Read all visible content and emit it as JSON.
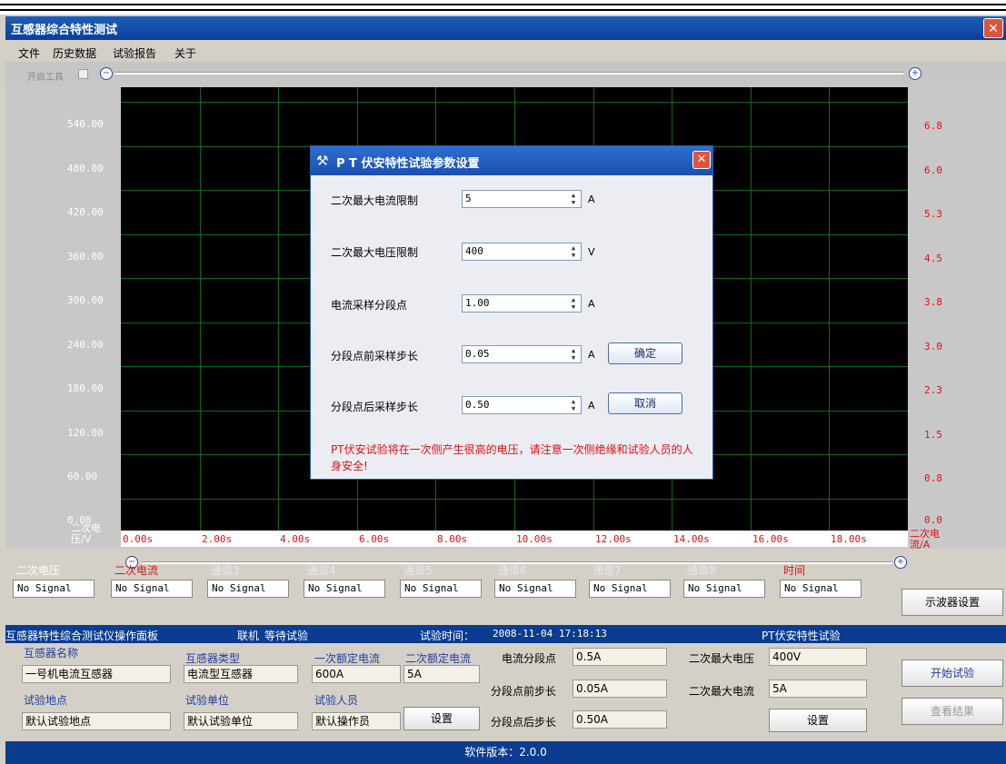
{
  "window": {
    "title": "互感器综合特性测试",
    "close_glyph": "✕"
  },
  "menu": [
    "文件",
    "历史数据",
    "试验报告",
    "关于"
  ],
  "toolbar": {
    "label": "开启工具"
  },
  "chart_data": {
    "type": "line",
    "x_ticks": [
      "0.00s",
      "2.00s",
      "4.00s",
      "6.00s",
      "8.00s",
      "10.00s",
      "12.00s",
      "14.00s",
      "16.00s",
      "18.00s"
    ],
    "y_left_ticks": [
      "540.00",
      "480.00",
      "420.00",
      "360.00",
      "300.00",
      "240.00",
      "180.00",
      "120.00",
      "60.00",
      "0.00"
    ],
    "y_right_ticks": [
      "6.8",
      "6.0",
      "5.3",
      "4.5",
      "3.8",
      "3.0",
      "2.3",
      "1.5",
      "0.8",
      "0.0"
    ],
    "ylabel_left": "二次电压/V",
    "ylabel_right": "二次电流/A",
    "series": []
  },
  "channels": [
    {
      "name": "二次电压",
      "value": "No Signal",
      "color": "#ffffff"
    },
    {
      "name": "二次电流",
      "value": "No Signal",
      "color": "#e01010"
    },
    {
      "name": "通道3",
      "value": "No Signal",
      "color": "#e8e8e8"
    },
    {
      "name": "通道4",
      "value": "No Signal",
      "color": "#e8e8e8"
    },
    {
      "name": "通道5",
      "value": "No Signal",
      "color": "#e8e8e8"
    },
    {
      "name": "通道6",
      "value": "No Signal",
      "color": "#e8e8e8"
    },
    {
      "name": "通道7",
      "value": "No Signal",
      "color": "#e8e8e8"
    },
    {
      "name": "通道8",
      "value": "No Signal",
      "color": "#e8e8e8"
    },
    {
      "name": "时间",
      "value": "No Signal",
      "color": "#e01010"
    }
  ],
  "scope_button": "示波器设置",
  "op_header": {
    "title": "互感器特性综合测试仪操作面板",
    "status": "联机",
    "state": "等待试验",
    "time_label": "试验时间：",
    "time_value": "2008-11-04 17:18:13",
    "test_type": "PT伏安特性试验"
  },
  "op": {
    "name_label": "互感器名称",
    "name_value": "一号机电流互感器",
    "type_label": "互感器类型",
    "type_value": "电流型互感器",
    "primary_label": "一次额定电流",
    "primary_value": "600A",
    "secondary_label": "二次额定电流",
    "secondary_value": "5A",
    "site_label": "试验地点",
    "site_value": "默认试验地点",
    "unit_label": "试验单位",
    "unit_value": "默认试验单位",
    "person_label": "试验人员",
    "person_value": "默认操作员",
    "setup_btn": "设置",
    "seg_label": "电流分段点",
    "seg_value": "0.5A",
    "before_label": "分段点前步长",
    "before_value": "0.05A",
    "after_label": "分段点后步长",
    "after_value": "0.50A",
    "maxv_label": "二次最大电压",
    "maxv_value": "400V",
    "maxi_label": "二次最大电流",
    "maxi_value": "5A",
    "setup_btn2": "设置",
    "start_btn": "开始试验",
    "result_btn": "查看结果"
  },
  "footer": "软件版本：2.0.0",
  "dialog": {
    "title": "P T 伏安特性试验参数设置",
    "rows": [
      {
        "label": "二次最大电流限制",
        "value": "5",
        "unit": "A"
      },
      {
        "label": "二次最大电压限制",
        "value": "400",
        "unit": "V"
      },
      {
        "label": "电流采样分段点",
        "value": "1.00",
        "unit": "A"
      },
      {
        "label": "分段点前采样步长",
        "value": "0.05",
        "unit": "A"
      },
      {
        "label": "分段点后采样步长",
        "value": "0.50",
        "unit": "A"
      }
    ],
    "ok": "确定",
    "cancel": "取消",
    "warning": "PT伏安试验将在一次侧产生很高的电压，请注意一次侧绝缘和试验人员的人身安全!"
  }
}
